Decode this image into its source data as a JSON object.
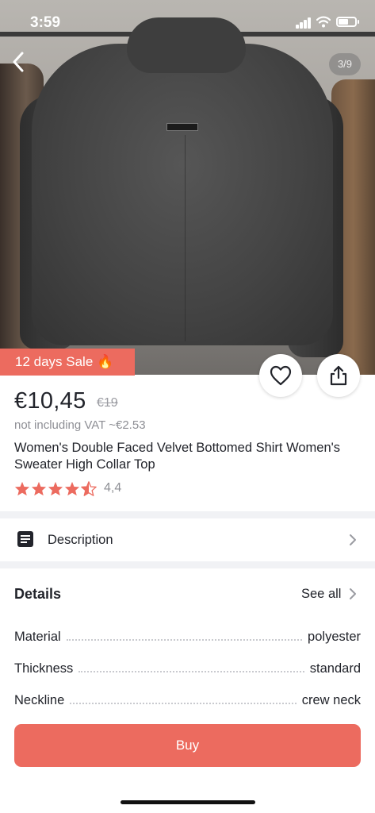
{
  "status_bar": {
    "time": "3:59"
  },
  "gallery": {
    "counter": "3/9"
  },
  "sale_badge": "12 days Sale 🔥",
  "product": {
    "price": "€10,45",
    "old_price": "€19",
    "vat_note": "not including VAT ~€2.53",
    "title": "Women's Double Faced Velvet Bottomed Shirt Women's Sweater High Collar Top",
    "rating_value": 4.4,
    "rating_text": "4,4"
  },
  "description": {
    "label": "Description"
  },
  "details": {
    "heading": "Details",
    "see_all": "See all",
    "attributes": [
      {
        "key": "Material",
        "value": "polyester"
      },
      {
        "key": "Thickness",
        "value": "standard"
      },
      {
        "key": "Neckline",
        "value": "crew neck"
      }
    ]
  },
  "buy_button": "Buy",
  "icons": {
    "back": "chevron-left-icon",
    "favorite": "heart-icon",
    "share": "share-icon",
    "description": "document-icon",
    "chevron": "chevron-right-icon",
    "star": "star-icon"
  },
  "colors": {
    "accent": "#ec6b5f",
    "star": "#ec6b5f",
    "text": "#22242b",
    "muted": "#8e8f95"
  }
}
